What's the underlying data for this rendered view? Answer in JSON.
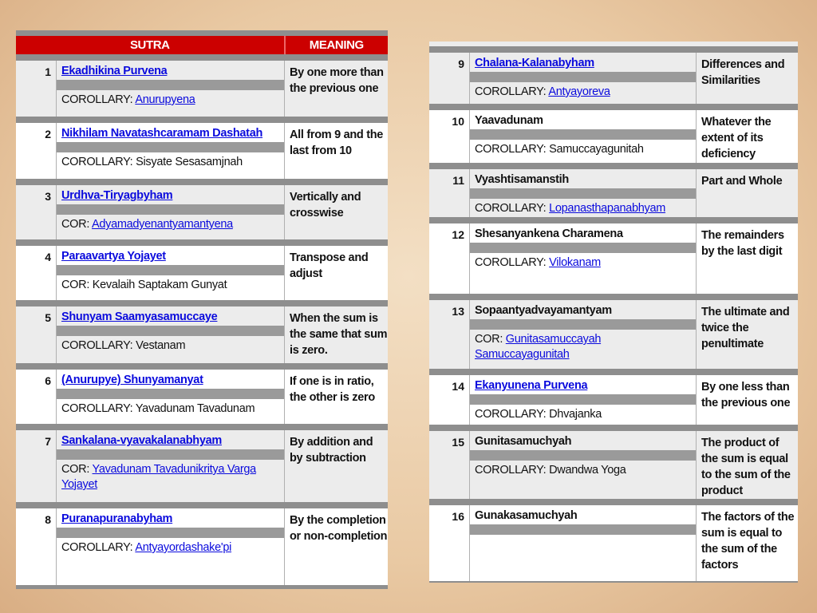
{
  "header": {
    "sutra": "SUTRA",
    "meaning": "MEANING"
  },
  "colors": {
    "header": "#cc0000",
    "link": "#0b0bdd",
    "rule": "#8e8e8e"
  },
  "rows": [
    {
      "num": "1",
      "sutra": "Ekadhikina Purvena",
      "sutra_link": true,
      "cor_label": "COROLLARY: ",
      "cor": "Anurupyena",
      "cor_link": true,
      "meaning": "By one more than the previous one"
    },
    {
      "num": "2",
      "sutra": "Nikhilam Navatashcaramam Dashatah",
      "sutra_link": true,
      "cor_label": "COROLLARY: ",
      "cor": "Sisyate Sesasamjnah",
      "cor_link": false,
      "meaning": "All from 9 and the last from 10"
    },
    {
      "num": "3",
      "sutra": "Urdhva-Tiryagbyham",
      "sutra_link": true,
      "cor_label": "COR: ",
      "cor": "Adyamadyenantyamantyena",
      "cor_link": true,
      "meaning": "Vertically and crosswise"
    },
    {
      "num": "4",
      "sutra": "Paraavartya Yojayet",
      "sutra_link": true,
      "cor_label": "COR: ",
      "cor": "Kevalaih Saptakam Gunyat",
      "cor_link": false,
      "meaning": "Transpose and adjust"
    },
    {
      "num": "5",
      "sutra": "Shunyam Saamyasamuccaye",
      "sutra_link": true,
      "cor_label": "COROLLARY: ",
      "cor": "Vestanam",
      "cor_link": false,
      "meaning": "When the sum is the same that sum is zero."
    },
    {
      "num": "6",
      "sutra": "(Anurupye) Shunyamanyat",
      "sutra_link": true,
      "cor_label": "COROLLARY: ",
      "cor": "Yavadunam Tavadunam",
      "cor_link": false,
      "meaning": "If one is in ratio, the other is zero"
    },
    {
      "num": "7",
      "sutra": "Sankalana-vyavakalanabhyam",
      "sutra_link": true,
      "cor_label": "COR: ",
      "cor": "Yavadunam Tavadunikritya Varga Yojayet",
      "cor_link": true,
      "meaning": "By addition and by subtraction"
    },
    {
      "num": "8",
      "sutra": "Puranapuranabyham",
      "sutra_link": true,
      "cor_label": "COROLLARY: ",
      "cor": "Antyayordashake'pi",
      "cor_link": true,
      "meaning": "By the completion or non-completion"
    },
    {
      "num": "9",
      "sutra": "Chalana-Kalanabyham",
      "sutra_link": true,
      "cor_label": "COROLLARY: ",
      "cor": "Antyayoreva",
      "cor_link": true,
      "meaning": "Differences and Similarities"
    },
    {
      "num": "10",
      "sutra": "Yaavadunam",
      "sutra_link": false,
      "cor_label": "COROLLARY: ",
      "cor": "Samuccayagunitah",
      "cor_link": false,
      "meaning": "Whatever the extent of its deficiency"
    },
    {
      "num": "11",
      "sutra": "Vyashtisamanstih",
      "sutra_link": false,
      "cor_label": "COROLLARY: ",
      "cor": "Lopanasthapanabhyam",
      "cor_link": true,
      "meaning": "Part and Whole"
    },
    {
      "num": "12",
      "sutra": "Shesanyankena Charamena",
      "sutra_link": false,
      "cor_label": "COROLLARY: ",
      "cor": "Vilokanam",
      "cor_link": true,
      "meaning": "The remainders by the last digit"
    },
    {
      "num": "13",
      "sutra": "Sopaantyadvayamantyam",
      "sutra_link": false,
      "cor_label": "COR: ",
      "cor": "Gunitasamuccayah Samuccayagunitah",
      "cor_link": true,
      "meaning": "The ultimate and twice the penultimate"
    },
    {
      "num": "14",
      "sutra": "Ekanyunena Purvena",
      "sutra_link": true,
      "cor_label": "COROLLARY: ",
      "cor": "Dhvajanka",
      "cor_link": false,
      "meaning": "By one less than the previous one"
    },
    {
      "num": "15",
      "sutra": "Gunitasamuchyah",
      "sutra_link": false,
      "cor_label": "COROLLARY: ",
      "cor": "Dwandwa Yoga",
      "cor_link": false,
      "meaning": "The product of the sum is equal to the sum of the product"
    },
    {
      "num": "16",
      "sutra": "Gunakasamuchyah",
      "sutra_link": false,
      "cor_label": "",
      "cor": "",
      "cor_link": false,
      "meaning": "The factors of the sum is equal to the sum of the factors"
    }
  ]
}
